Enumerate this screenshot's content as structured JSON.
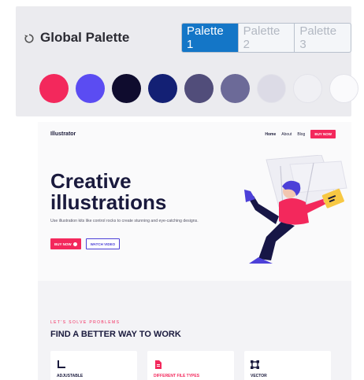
{
  "palette_panel": {
    "title": "Global Palette",
    "reset_icon": "reset-icon",
    "tabs": [
      {
        "label": "Palette 1",
        "active": true
      },
      {
        "label": "Palette 2",
        "active": false
      },
      {
        "label": "Palette 3",
        "active": false
      }
    ],
    "swatches": [
      "#f3285c",
      "#5b4cf2",
      "#0f0c2e",
      "#132074",
      "#514d7a",
      "#6c6a98",
      "#dcdbe6",
      "#f0f0f4",
      "#fafafc"
    ]
  },
  "site": {
    "logo": "Illustrator",
    "nav": {
      "home": "Home",
      "about": "About",
      "blog": "Blog",
      "cta": "BUY NOW"
    },
    "hero": {
      "title_line1": "Creative",
      "title_line2": "illustrations",
      "description": "Use illustration kits like control rocks to create stunning and eye-catching designs.",
      "primary_button": "BUY NOW",
      "secondary_button": "WATCH VIDEO"
    },
    "features": {
      "eyebrow": "LET'S SOLVE PROBLEMS",
      "title": "FIND A BETTER WAY TO WORK",
      "cards": [
        {
          "label": "ADJUSTABLE",
          "icon": "adjustable-icon"
        },
        {
          "label": "DIFFERENT FILE TYPES",
          "icon": "file-icon"
        },
        {
          "label": "VECTOR",
          "icon": "vector-icon"
        }
      ]
    }
  },
  "colors": {
    "accent": "#f3285c",
    "primary_blue": "#1476c7",
    "dark": "#1a1a3d",
    "violet": "#4b3fd6"
  }
}
